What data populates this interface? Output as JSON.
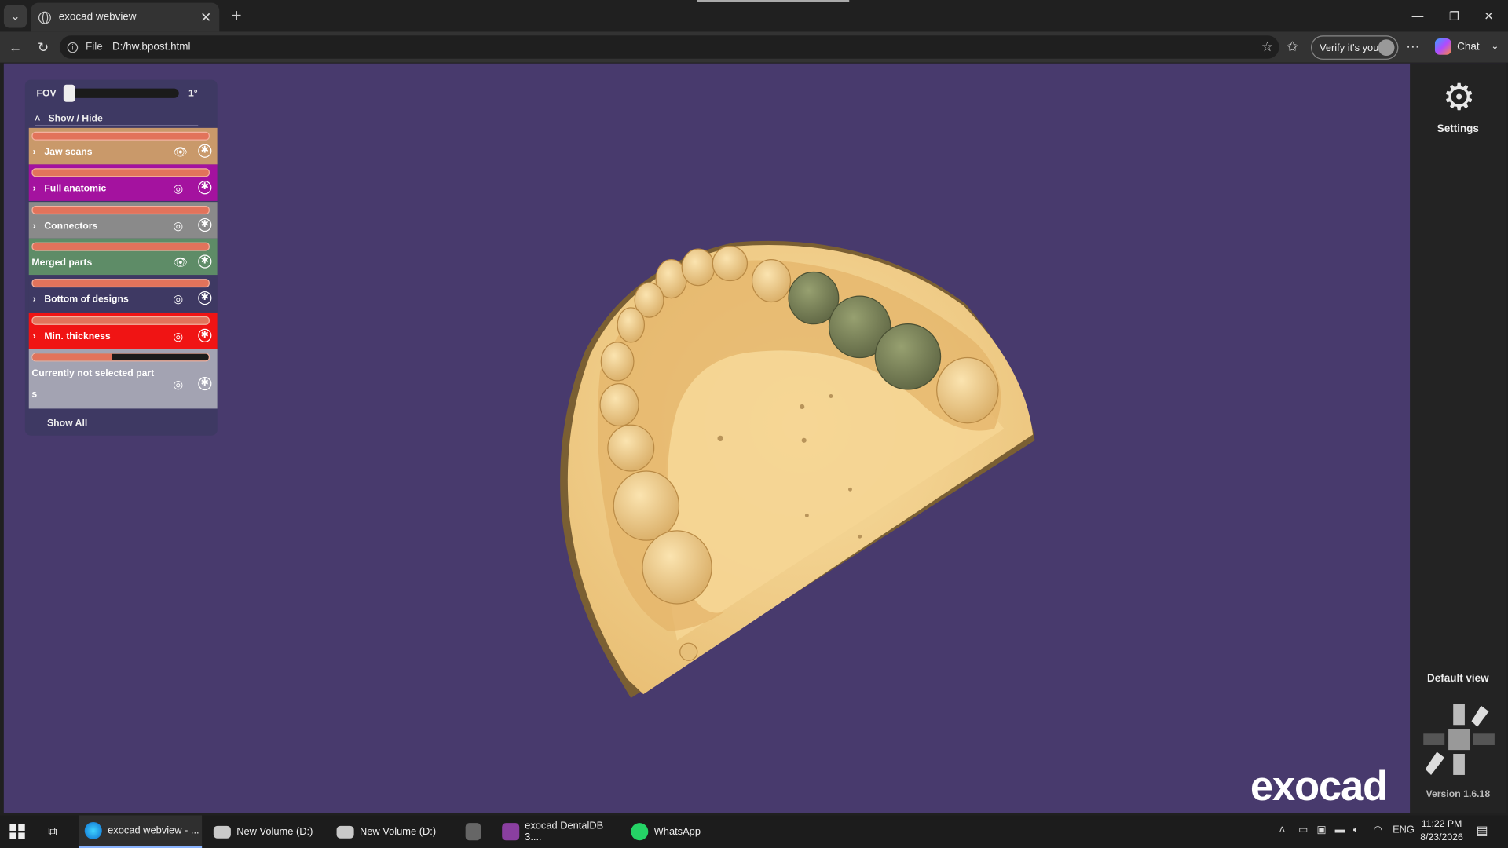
{
  "browser": {
    "tab_title": "exocad webview",
    "address_prefix": "File",
    "address": "D:/hw.bpost.html",
    "verify_label": "Verify it's you",
    "chat_label": "Chat"
  },
  "panel": {
    "fov_label": "FOV",
    "fov_value": "1°",
    "fov_fraction": 0.0,
    "show_hide_label": "Show / Hide",
    "show_all_label": "Show All",
    "rows": [
      {
        "label": "Jaw scans",
        "color": "#c9996a",
        "expandable": true,
        "visible": true
      },
      {
        "label": "Full anatomic",
        "color": "#a4129f",
        "expandable": true,
        "visible": false
      },
      {
        "label": "Connectors",
        "color": "#8a8a8a",
        "expandable": true,
        "visible": false
      },
      {
        "label": "Merged parts",
        "color": "#5e8c67",
        "expandable": false,
        "visible": true
      },
      {
        "label": "Bottom of designs",
        "color": "#3e3963",
        "expandable": true,
        "visible": false
      },
      {
        "label": "Min. thickness",
        "color": "#f01414",
        "expandable": true,
        "visible": false
      },
      {
        "label": "Currently not selected part",
        "label2": "s",
        "color": "#a3a3b2",
        "expandable": false,
        "visible": false,
        "bar_fraction": 0.45
      }
    ]
  },
  "rightbar": {
    "settings_label": "Settings",
    "default_view_label": "Default view",
    "version": "Version 1.6.18"
  },
  "brand": {
    "logo_text": "exocad"
  },
  "taskbar": {
    "items": [
      {
        "label": "exocad webview - ..."
      },
      {
        "label": "New Volume (D:)"
      },
      {
        "label": "New Volume (D:)"
      },
      {
        "label": ""
      },
      {
        "label": "exocad DentalDB 3...."
      },
      {
        "label": "WhatsApp"
      }
    ],
    "language": "ENG",
    "time": "11:22 PM",
    "date": "8/23/2026"
  },
  "colors": {
    "viewer_bg": "#483a6d",
    "model": "#f2cd86",
    "crowns": "#7e845b"
  }
}
